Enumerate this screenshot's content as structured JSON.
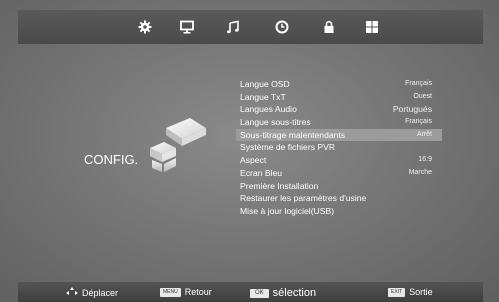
{
  "top_bar": {
    "icons": [
      "gear-icon",
      "monitor-icon",
      "music-icon",
      "clock-icon",
      "lock-icon",
      "grid-icon"
    ],
    "active_index": 5
  },
  "section_title": "CONFIG.",
  "menu": {
    "items": [
      {
        "label": "Langue OSD",
        "value": "Français"
      },
      {
        "label": "Langue TxT",
        "value": "Ouest"
      },
      {
        "label": "Langues Audio",
        "value": "Portugués"
      },
      {
        "label": "Langue  sous-titres",
        "value": "Français"
      },
      {
        "label": "Sous-titrage malentendants",
        "value": "Arrêt"
      },
      {
        "label": "Système de fichiers PVR",
        "value": ""
      },
      {
        "label": "Aspect",
        "value": "16:9"
      },
      {
        "label": "Ecran Bleu",
        "value": "Marche"
      },
      {
        "label": "Première Installation",
        "value": ""
      },
      {
        "label": "Restaurer les paramètres d'usine",
        "value": ""
      },
      {
        "label": "Mise à jour logiciel(USB)",
        "value": ""
      }
    ],
    "selected_index": 4
  },
  "bottom_bar": {
    "move_label": "Déplacer",
    "menu_key": "MENU",
    "back_label": "Retour",
    "ok_key": "OK",
    "select_label": "sélection",
    "exit_key": "EXIT",
    "exit_label": "Sortie"
  },
  "colors": {
    "highlight": "#9b9b9b",
    "bar": "#4a4a4a",
    "text": "#ffffff"
  }
}
